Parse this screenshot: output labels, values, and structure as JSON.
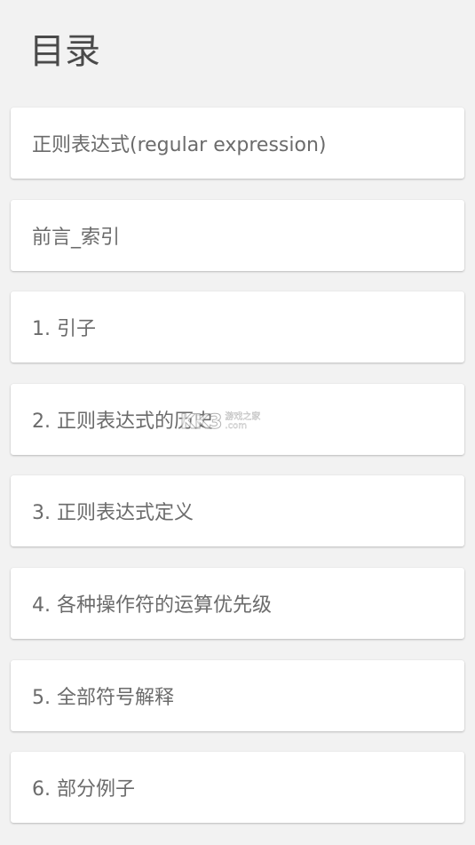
{
  "page": {
    "title": "目录"
  },
  "toc": {
    "items": [
      {
        "label": "正则表达式(regular expression)"
      },
      {
        "label": "前言_索引"
      },
      {
        "label": "1. 引子"
      },
      {
        "label": "2. 正则表达式的历史"
      },
      {
        "label": "3. 正则表达式定义"
      },
      {
        "label": "4. 各种操作符的运算优先级"
      },
      {
        "label": "5. 全部符号解释"
      },
      {
        "label": "6. 部分例子"
      }
    ]
  },
  "watermark": {
    "logo": "KK3",
    "line1": "游戏之家",
    "line2": ".com"
  }
}
